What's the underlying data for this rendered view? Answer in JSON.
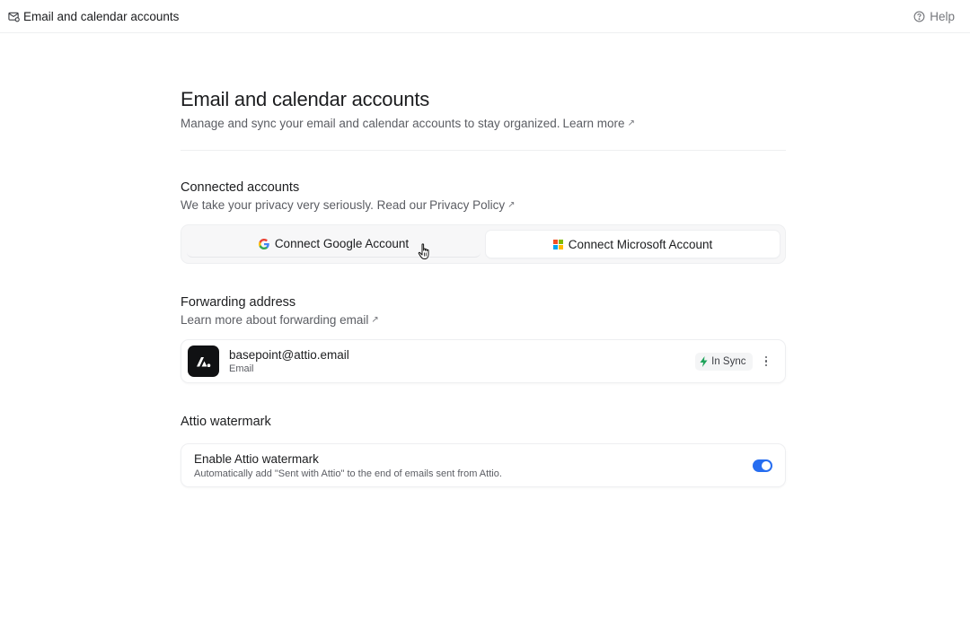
{
  "topbar": {
    "title": "Email and calendar accounts",
    "title_icon": "mail-settings-icon",
    "help_label": "Help",
    "help_icon": "help-circle-icon"
  },
  "header": {
    "title": "Email and calendar accounts",
    "subtitle": "Manage and sync your email and calendar accounts to stay organized.",
    "learn_more": "Learn more",
    "external_arrow": "↗"
  },
  "connected": {
    "title": "Connected accounts",
    "subtitle": "We take your privacy very seriously. Read our",
    "privacy_link": "Privacy Policy",
    "external_arrow": "↗",
    "google_label": "Connect Google Account",
    "microsoft_label": "Connect Microsoft Account",
    "google_icon": "google-icon",
    "microsoft_icon": "microsoft-icon"
  },
  "forwarding": {
    "title": "Forwarding address",
    "link": "Learn more about forwarding email",
    "external_arrow": "↗",
    "email": "basepoint@attio.email",
    "type": "Email",
    "status": "In Sync",
    "status_icon": "lightning-icon",
    "status_color": "#1ea35a"
  },
  "watermark": {
    "title": "Attio watermark",
    "toggle_title": "Enable Attio watermark",
    "toggle_desc": "Automatically add \"Sent with Attio\" to the end of emails sent from Attio.",
    "enabled": true,
    "accent": "#266df0"
  }
}
